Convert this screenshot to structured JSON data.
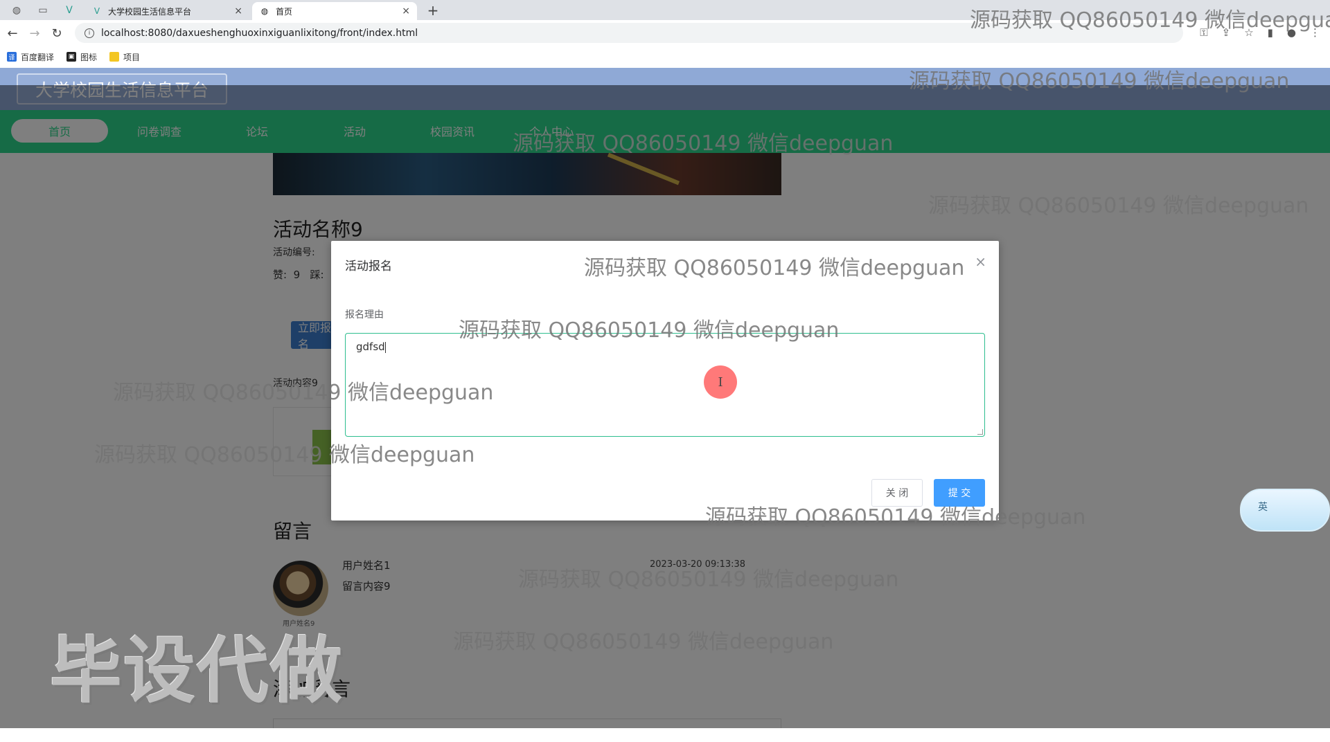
{
  "browser": {
    "tabs": [
      {
        "label": "大学校园生活信息平台",
        "active": false
      },
      {
        "label": "首页",
        "active": true
      }
    ],
    "new_tab": "+",
    "url": "localhost:8080/daxueshenghuoxinxiguanlixitong/front/index.html",
    "bookmarks": [
      "百度翻译",
      "图标",
      "项目"
    ]
  },
  "site": {
    "title": "大学校园生活信息平台",
    "nav": [
      {
        "label": "首页",
        "active": true
      },
      {
        "label": "问卷调查",
        "active": false
      },
      {
        "label": "论坛",
        "active": false
      },
      {
        "label": "活动",
        "active": false
      },
      {
        "label": "校园资讯",
        "active": false
      },
      {
        "label": "个人中心",
        "active": false
      }
    ]
  },
  "activity": {
    "name": "活动名称9",
    "number_label": "活动编号:",
    "likes_line": "赞:  9   踩:",
    "signup_button": "立即报名",
    "content_label": "活动内容9"
  },
  "comments": {
    "heading": "留言",
    "items": [
      {
        "user": "用户姓名1",
        "text": "留言内容9",
        "time": "2023-03-20 09:13:38",
        "avatar_caption": "用户姓名9"
      }
    ],
    "add_heading": "添加留言"
  },
  "dialog": {
    "title": "活动报名",
    "close_symbol": "×",
    "field_label": "报名理由",
    "field_value": "gdfsd",
    "close_button": "关 闭",
    "submit_button": "提 交"
  },
  "cursor_glyph": "I",
  "ime": {
    "label": "英"
  },
  "watermark": {
    "text": "源码获取 QQ86050149 微信deepguan",
    "text_cut": "源码获取 QQ86050149 微信deepgua",
    "big": "毕设代做"
  },
  "colors": {
    "nav_green": "#2dd78c",
    "header_blue": "#8fa9d6",
    "submit_blue": "#409eff"
  }
}
